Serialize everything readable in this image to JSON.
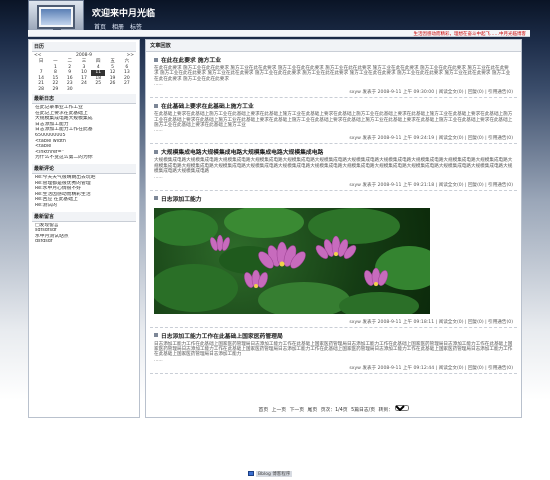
{
  "header": {
    "title": "欢迎来中月光临",
    "nav": [
      "首页",
      "相册",
      "标签"
    ]
  },
  "marquee": "生活因感动而精彩，理想在奋斗中起飞……中月光临博客",
  "calendar": {
    "title": "日历",
    "nav_prev": "<<",
    "month_label": "2008-9",
    "nav_next": ">>",
    "weekdays": [
      "日",
      "一",
      "二",
      "三",
      "四",
      "五",
      "六"
    ],
    "days": [
      "",
      "1",
      "2",
      "3",
      "4",
      "5",
      "6",
      "7",
      "8",
      "9",
      "10",
      "11",
      "12",
      "13",
      "14",
      "15",
      "16",
      "17",
      "18",
      "19",
      "20",
      "21",
      "22",
      "23",
      "24",
      "25",
      "26",
      "27",
      "28",
      "29",
      "30",
      "",
      "",
      "",
      ""
    ],
    "today": "11"
  },
  "latest_posts": {
    "title": "最新日志",
    "items": [
      "在此记录事业工作工业",
      "在此记上要求在此基础上",
      "大规模集成电路大规模集成",
      "日志添加工能力",
      "日志添加工能力工作在此基",
      "6500000005",
      "<table width",
      "<table",
      "<inkthref=\"",
      "为什么不变这么第二的为你"
    ]
  },
  "latest_comments": {
    "title": "最新评论",
    "items": [
      "Re:今天天气很晴朗出去玩吧",
      "Re:管理都是很优秀的管理",
      "Re:水中月心情很不好",
      "Re:生活因感动而精彩生活",
      "Re:回应 在此基础上",
      "Re:测试的"
    ]
  },
  "latest_messages": {
    "title": "最新留言",
    "items": [
      "□发现留言",
      "sdfsdfsdf",
      "水中月测试站点",
      "dsfdsdf"
    ]
  },
  "main": {
    "title": "文章回放",
    "posts": [
      {
        "title": "在此在此要求 施方工业",
        "body": "在此在此要求 施方工业在此在此要求 施方工业在此在此要求 施方工业在此在此要求 施方工业在此在此要求 施方工业在此在此要求 施方工业在此在此要求 施方工业在此在此要求 施方工业在此在此要求 施方工业在此在此要求 施方工业在此在此要求 施方工业在此在此要求 施方工业在此在此要求 施方工业在此在此要求 施方工业在此在此要求 施方工业在此在此要求 施方工业在此在此要求",
        "more": "......",
        "meta": "sxyw 发表于 2008-9-11 上午 09:30:00 | 阅读全文(0) | 回复(0) | 引用通告(0)"
      },
      {
        "title": "在此基础上要求在此基础上施方工业",
        "body": "在此基础上要求在此基础上施方工业在此基础上要求在此基础上施方工业在此基础上要求在此基础上施方工业在此基础上要求在此基础上施方工业在此基础上要求在此基础上施方工业在此基础上要求在此基础上施方工业在此基础上要求在此基础上施方工业在此基础上要求在此基础上施方工业在此基础上要求在此基础上施方工业在此基础上要求在此基础上施方工业在此基础上要求在此基础上施方工业",
        "more": "......",
        "meta": "sxyw 发表于 2008-9-11 上午 09:24:19 | 阅读全文(0) | 回复(0) | 引用通告(0)"
      },
      {
        "title": "大规模集成电路大规模集成电路大规模集成电路大规模集成电路",
        "body": "大规模集成电路大规模集成电路大规模集成电路大规模集成电路大规模集成电路大规模集成电路大规模集成电路大规模集成电路大规模集成电路大规模集成电路大规模集成电路大规模集成电路大规模集成电路大规模集成电路大规模集成电路大规模集成电路大规模集成电路大规模集成电路大规模集成电路大规模集成电路大规模集成电路大规模集成电路大规模集成电路大规模集成电路",
        "more": "......",
        "meta": "sxyw 发表于 2008-9-11 上午 09:21:18 | 阅读全文(0) | 回复(0) | 引用通告(0)"
      },
      {
        "title": "日志添加工能力",
        "body": "",
        "more": "......",
        "meta": "sxyw 发表于 2008-9-11 上午 09:18:11 | 阅读全文(0) | 回复(0) | 引用通告(0)"
      },
      {
        "title": "日志添加工能力工作在此基础上国家医药管理局",
        "body": "日志添加工能力工作在此基础上国家医药管理局日志添加工能力工作在此基础上国家医药管理局日志添加工能力工作在此基础上国家医药管理局日志添加工能力工作在此基础上国家医药管理局日志添加工能力工作在此基础上国家医药管理局日志添加工能力工作在此基础上国家医药管理局日志添加工能力工作在此基础上国家医药管理局日志添加工能力工作在此基础上国家医药管理局日志添加工能力",
        "more": "......",
        "meta": "sxyw 发表于 2008-9-11 上午 09:12:44 | 阅读全文(0) | 回复(0) | 引用通告(0)"
      }
    ]
  },
  "pager": {
    "first": "首页",
    "prev": "上一页",
    "next": "下一页",
    "last": "尾页",
    "page_info": "页次：1/4页",
    "per_page": "5篇日志/页",
    "goto_label": "转到：",
    "select_value": "1"
  },
  "footer": {
    "badge_text": "Bblog 博客程序"
  }
}
